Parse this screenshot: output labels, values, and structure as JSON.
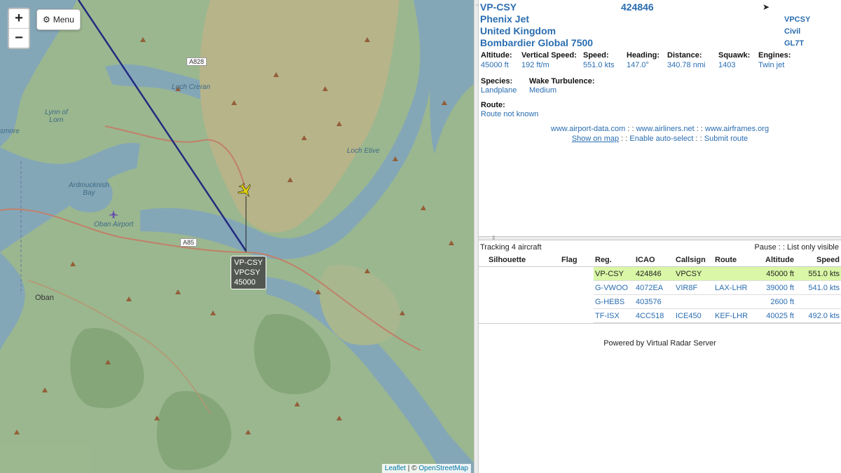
{
  "map": {
    "zoom_in": "+",
    "zoom_out": "−",
    "menu_label": "Menu",
    "places": {
      "more": "smore",
      "lynn_of_lorn": "Lynn of\nLorn",
      "loch_creran": "Loch Creran",
      "ardmucknish_bay": "Ardmucknish\nBay",
      "oban_airport": "Oban Airport",
      "oban": "Oban",
      "loch_etive": "Loch Etive"
    },
    "roads": {
      "a828": "A828",
      "a85": "A85"
    },
    "aircraft_label": {
      "line1": "VP-CSY",
      "line2": "VPCSY",
      "line3": "45000"
    },
    "attribution": {
      "leaflet": "Leaflet",
      "sep": " | © ",
      "osm": "OpenStreetMap"
    }
  },
  "detail": {
    "registration": "VP-CSY",
    "icao": "424846",
    "operator": "Phenix Jet",
    "country": "United Kingdom",
    "model": "Bombardier Global 7500",
    "callsign": "VPCSY",
    "type_class": "Civil",
    "type_code": "GL7T",
    "fields": {
      "altitude_label": "Altitude:",
      "altitude": "45000 ft",
      "vspeed_label": "Vertical Speed:",
      "vspeed": "192 ft/m",
      "speed_label": "Speed:",
      "speed": "551.0 kts",
      "heading_label": "Heading:",
      "heading": "147.0°",
      "distance_label": "Distance:",
      "distance": "340.78 nmi",
      "squawk_label": "Squawk:",
      "squawk": "1403",
      "engines_label": "Engines:",
      "engines": "Twin jet",
      "species_label": "Species:",
      "species": "Landplane",
      "wake_label": "Wake Turbulence:",
      "wake": "Medium",
      "route_label": "Route:",
      "route": "Route not known"
    },
    "links": {
      "airport_data": "www.airport-data.com",
      "airliners": "www.airliners.net",
      "airframes": "www.airframes.org",
      "sep": " : : ",
      "show_on_map": "Show on map",
      "auto_select": "Enable auto-select",
      "submit_route": "Submit route"
    }
  },
  "list": {
    "tracking": "Tracking 4 aircraft",
    "pause": "Pause",
    "pause_sep": " : : ",
    "visible": "List only visible",
    "headers": [
      "Silhouette",
      "Flag",
      "Reg.",
      "ICAO",
      "Callsign",
      "Route",
      "Altitude",
      "Speed"
    ],
    "rows": [
      {
        "reg": "VP-CSY",
        "icao": "424846",
        "callsign": "VPCSY",
        "route": "",
        "altitude": "45000 ft",
        "speed": "551.0 kts"
      },
      {
        "reg": "G-VWOO",
        "icao": "4072EA",
        "callsign": "VIR8F",
        "route": "LAX-LHR",
        "altitude": "39000 ft",
        "speed": "541.0 kts"
      },
      {
        "reg": "G-HEBS",
        "icao": "403576",
        "callsign": "",
        "route": "",
        "altitude": "2600 ft",
        "speed": ""
      },
      {
        "reg": "TF-ISX",
        "icao": "4CC518",
        "callsign": "ICE450",
        "route": "KEF-LHR",
        "altitude": "40025 ft",
        "speed": "492.0 kts"
      }
    ],
    "powered_by": "Powered by Virtual Radar Server"
  }
}
